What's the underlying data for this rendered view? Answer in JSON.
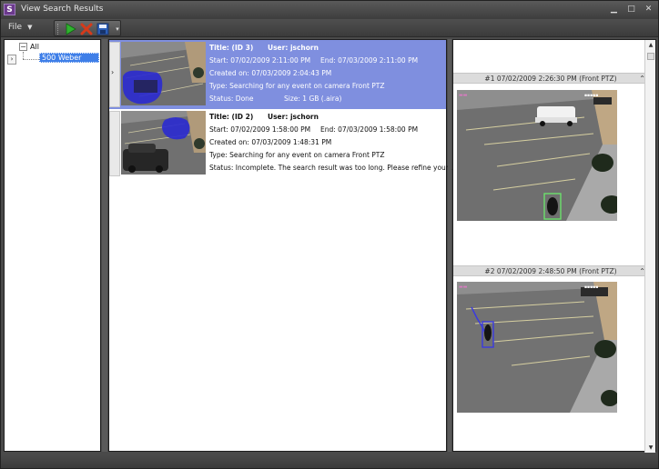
{
  "window": {
    "app_icon": "S",
    "title": "View Search Results",
    "minimize": "▁",
    "restore": "□",
    "close": "✕"
  },
  "toolbar": {
    "file_label": "File",
    "play_icon": "play-icon",
    "delete_icon": "delete-icon",
    "save_icon": "save-icon"
  },
  "tree": {
    "root_label": "All",
    "child_label": "500 Weber"
  },
  "results": [
    {
      "title": "Title: (ID 3)",
      "user": "User: jschorn",
      "start": "Start: 07/02/2009 2:11:00 PM",
      "end": "End: 07/03/2009 2:11:00 PM",
      "created": "Created on: 07/03/2009 2:04:43 PM",
      "type": "Type: Searching for any event on camera Front PTZ",
      "status": "Status: Done",
      "size": "Size: 1 GB (.aira)",
      "selected": true
    },
    {
      "title": "Title: (ID 2)",
      "user": "User: jschorn",
      "start": "Start: 07/02/2009 1:58:00 PM",
      "end": "End: 07/03/2009 1:58:00 PM",
      "created": "Created on: 07/03/2009 1:48:31 PM",
      "type": "Type: Searching for any event on camera Front PTZ",
      "status": "Status: Incomplete.  The search result was too long.  Please refine your...",
      "selected": false
    }
  ],
  "frames": [
    {
      "header": "#1 07/02/2009 2:26:30 PM (Front PTZ)"
    },
    {
      "header": "#2 07/02/2009 2:48:50 PM (Front PTZ)"
    }
  ],
  "colors": {
    "selected_row": "#7f8fdf",
    "highlight_blob": "#2a2ad0",
    "detection_box": "#6be06b",
    "track_box": "#3a3ae0"
  }
}
